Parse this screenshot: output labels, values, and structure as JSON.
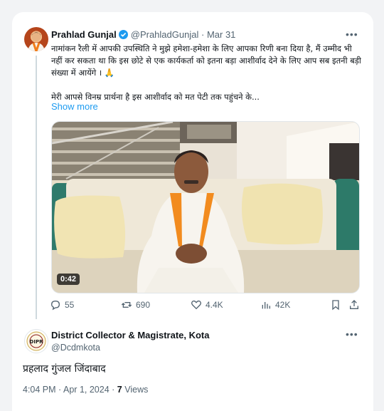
{
  "tweet": {
    "author_name": "Prahlad Gunjal",
    "author_handle": "@PrahladGunjal",
    "separator": "·",
    "date": "Mar 31",
    "more_label": "•••",
    "text_line1": "नामांकन रैली में आपकी उपस्थिति ने मुझे हमेशा-हमेशा के लिए आपका रिणी बना दिया है, मैं उम्मीद भी नहीं कर सकता था कि इस छोटे से एक कार्यकर्ता को इतना बड़ा आशीर्वाद देने के लिए आप सब इतनी बड़ी संख्या में आयेंगे । 🙏",
    "text_line2": "मेरी आपसे विनम्र प्रार्थना है इस आशीर्वाद को मत पेटी तक पहुंचने के...",
    "show_more": "Show more",
    "video_duration": "0:42",
    "stats": {
      "replies": "55",
      "reposts": "690",
      "likes": "4.4K",
      "views": "42K"
    }
  },
  "reply": {
    "author_name": "District Collector & Magistrate, Kota",
    "author_handle": "@Dcdmkota",
    "avatar_text": "DIPR",
    "more_label": "•••",
    "text": "प्रहलाद गुंजल जिंदाबाद",
    "time": "4:04 PM",
    "separator": "·",
    "date": "Apr 1, 2024",
    "views_count": "7",
    "views_label": "Views"
  },
  "colors": {
    "accent": "#1d9bf0",
    "text_primary": "#0f1419",
    "text_secondary": "#536471"
  },
  "icons": [
    "verified-badge-icon",
    "reply-icon",
    "repost-icon",
    "like-icon",
    "views-icon",
    "bookmark-icon",
    "share-icon",
    "more-icon"
  ]
}
